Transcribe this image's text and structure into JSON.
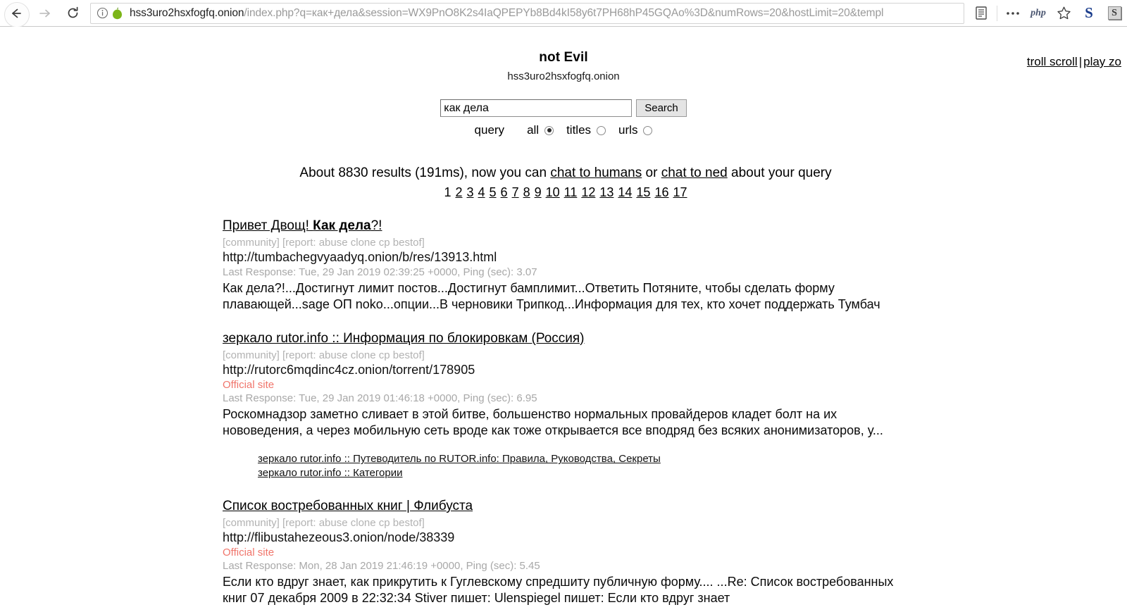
{
  "browser": {
    "back_label": "Back",
    "forward_label": "Forward",
    "reload_label": "Reload",
    "url_host": "hss3uro2hsxfogfq.onion",
    "url_path": "/index.php?q=как+дела&session=WX9PnO8K2s4IaQPEPYb8Bd4kI58y6t7PH68hP45GQAo%3D&numRows=20&hostLimit=20&templ",
    "icons": {
      "info": "info-icon",
      "onion": "onion-icon",
      "reader": "reader-mode-icon",
      "dots": "overflow-menu-icon",
      "php": "php",
      "star": "bookmark-star-icon",
      "s_blue": "S",
      "s_grey": "S"
    }
  },
  "toplinks": {
    "troll": "troll scroll",
    "separator": "|",
    "play": "play zo"
  },
  "site": {
    "title": "not Evil",
    "host": "hss3uro2hsxfogfq.onion"
  },
  "search": {
    "query_value": "как дела",
    "placeholder": "",
    "button_label": "Search",
    "mode_label": "query",
    "options": [
      {
        "label": "all",
        "checked": true
      },
      {
        "label": "titles",
        "checked": false
      },
      {
        "label": "urls",
        "checked": false
      }
    ]
  },
  "stats": {
    "prefix": "About 8830 results (191ms), now you can ",
    "link1": "chat to humans",
    "middle": " or ",
    "link2": "chat to ned",
    "suffix": " about your query"
  },
  "pager": {
    "current": "1",
    "pages": [
      "2",
      "3",
      "4",
      "5",
      "6",
      "7",
      "8",
      "9",
      "10",
      "11",
      "12",
      "13",
      "14",
      "15",
      "16",
      "17"
    ]
  },
  "results": [
    {
      "title_plain_pre": "Привет Двощ! ",
      "title_bold": "Как дела",
      "title_plain_post": "?!",
      "tags": "[community] [report: abuse clone cp bestof]",
      "url": "http://tumbachegvyaadyq.onion/b/res/13913.html",
      "official": "",
      "meta": "Last Response: Tue, 29 Jan 2019 02:39:25 +0000, Ping (sec): 3.07",
      "snippet": "Как дела?!...Достигнут лимит постов...Достигнут бамплимит...Ответить Потяните, чтобы сделать форму плавающей...sage ОП noko...опции...В черновики Трипкод...Информация для тех, кто хочет поддержать Тумбач",
      "sublinks": []
    },
    {
      "title_plain_pre": "зеркало rutor.info :: Информация по блокировкам (Россия)",
      "title_bold": "",
      "title_plain_post": "",
      "tags": "[community] [report: abuse clone cp bestof]",
      "url": "http://rutorc6mqdinc4cz.onion/torrent/178905",
      "official": "Official site",
      "meta": "Last Response: Tue, 29 Jan 2019 01:46:18 +0000, Ping (sec): 6.95",
      "snippet": "Роскомнадзор заметно сливает в этой битве, большенство нормальных провайдеров кладет болт на их нововедения, а через мобильную сеть вроде как тоже открывается все вподряд без всяких анонимизаторов, у...",
      "sublinks": [
        "зеркало rutor.info :: Путеводитель по RUTOR.info: Правила, Руководства, Секреты",
        "зеркало rutor.info :: Категории"
      ]
    },
    {
      "title_plain_pre": "Список востребованных книг | Флибуста",
      "title_bold": "",
      "title_plain_post": "",
      "tags": "[community] [report: abuse clone cp bestof]",
      "url": "http://flibustahezeous3.onion/node/38339",
      "official": "Official site",
      "meta": "Last Response: Mon, 28 Jan 2019 21:46:19 +0000, Ping (sec): 5.45",
      "snippet": "Если кто вдруг знает, как прикрутить к Гуглевскому спредшиту публичную форму.... ...Re: Список востребованных книг  07 декабря 2009  в 22:32:34 Stiver пишет:   Ulenspiegel пишет:   Если кто вдруг знает",
      "sublinks": []
    }
  ],
  "colors": {
    "official_site": "#f0756b",
    "tag_grey": "#b2b2b2",
    "meta_grey": "#a8a8a8",
    "onion_green": "#7cb518"
  }
}
